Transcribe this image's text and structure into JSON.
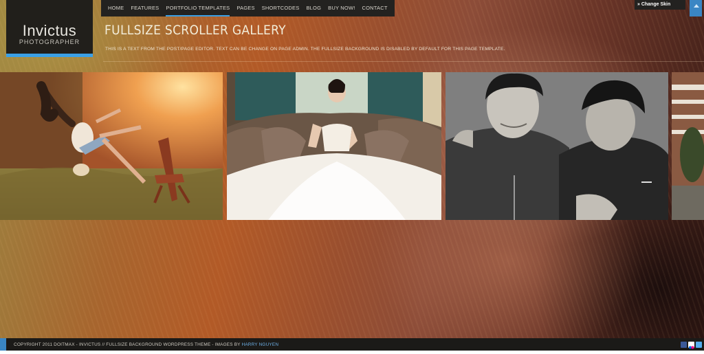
{
  "logo": {
    "name": "Invictus",
    "sub": "PHOTOGRAPHER"
  },
  "nav": [
    "HOME",
    "FEATURES",
    "PORTFOLIO TEMPLATES",
    "PAGES",
    "SHORTCODES",
    "BLOG",
    "BUY NOW!",
    "CONTACT"
  ],
  "nav_active_index": 2,
  "skin": {
    "label": "» Change Skin"
  },
  "page": {
    "title": "FULLSIZE SCROLLER GALLERY",
    "intro": "THIS IS A TEXT FROM THE POST/PAGE EDITOR. TEXT CAN BE CHANGE ON PAGE ADMIN. THE FULLSIZE BACKGROUND IS DISABLED BY DEFAULT FOR THIS PAGE TEMPLATE."
  },
  "footer": {
    "text": "COPYRIGHT 2011 DOITMAX - INVICTUS // FULLSIZE BACKGROUND WORDPRESS THEME - IMAGES BY ",
    "link": "HARRY NGUYEN"
  },
  "social_icons": [
    "facebook-icon",
    "flickr-icon",
    "twitter-icon"
  ],
  "colors": {
    "accent": "#3aa0e6",
    "nav_bg": "#232220"
  }
}
